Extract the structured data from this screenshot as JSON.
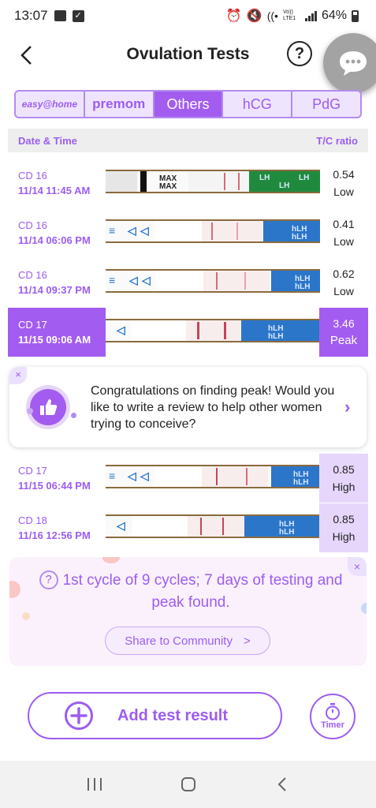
{
  "status_bar": {
    "time": "13:07",
    "battery": "64%",
    "network": "Vo)) LTE1"
  },
  "header": {
    "title": "Ovulation Tests",
    "help_symbol": "?"
  },
  "brand_tabs": [
    {
      "label": "easy@home",
      "active": false
    },
    {
      "label": "premom",
      "active": false
    },
    {
      "label": "Others",
      "active": true
    },
    {
      "label": "hCG",
      "active": false
    },
    {
      "label": "PdG",
      "active": false
    }
  ],
  "table": {
    "col_date": "Date & Time",
    "col_ratio": "T/C ratio",
    "rows": [
      {
        "cd": "CD 16",
        "datetime": "11/14  11:45 AM",
        "ratio": "0.54",
        "level": "Low"
      },
      {
        "cd": "CD 16",
        "datetime": "11/14  06:06 PM",
        "ratio": "0.41",
        "level": "Low"
      },
      {
        "cd": "CD 16",
        "datetime": "11/14  09:37 PM",
        "ratio": "0.62",
        "level": "Low"
      },
      {
        "cd": "CD 17",
        "datetime": "11/15  09:06 AM",
        "ratio": "3.46",
        "level": "Peak"
      },
      {
        "cd": "CD 17",
        "datetime": "11/15  06:44 PM",
        "ratio": "0.85",
        "level": "High"
      },
      {
        "cd": "CD 18",
        "datetime": "11/16  12:56 PM",
        "ratio": "0.85",
        "level": "High"
      }
    ]
  },
  "strip_labels": {
    "max": "MAX",
    "lh": "LH",
    "hlh": "hLH"
  },
  "review_card": {
    "close": "×",
    "text": "Congratulations on finding peak! Would you like to write a review to help other women trying to conceive?",
    "arrow": "›"
  },
  "cycle_card": {
    "close": "×",
    "q": "?",
    "text": "1st cycle of 9 cycles; 7 days of testing and peak found.",
    "share_label": "Share to Community",
    "share_arrow": ">"
  },
  "actions": {
    "add_label": "Add test result",
    "timer_label": "Timer"
  },
  "colors": {
    "accent": "#a35cf0",
    "accent_text": "#9c5df0",
    "accent_soft": "#e6d6fb"
  }
}
